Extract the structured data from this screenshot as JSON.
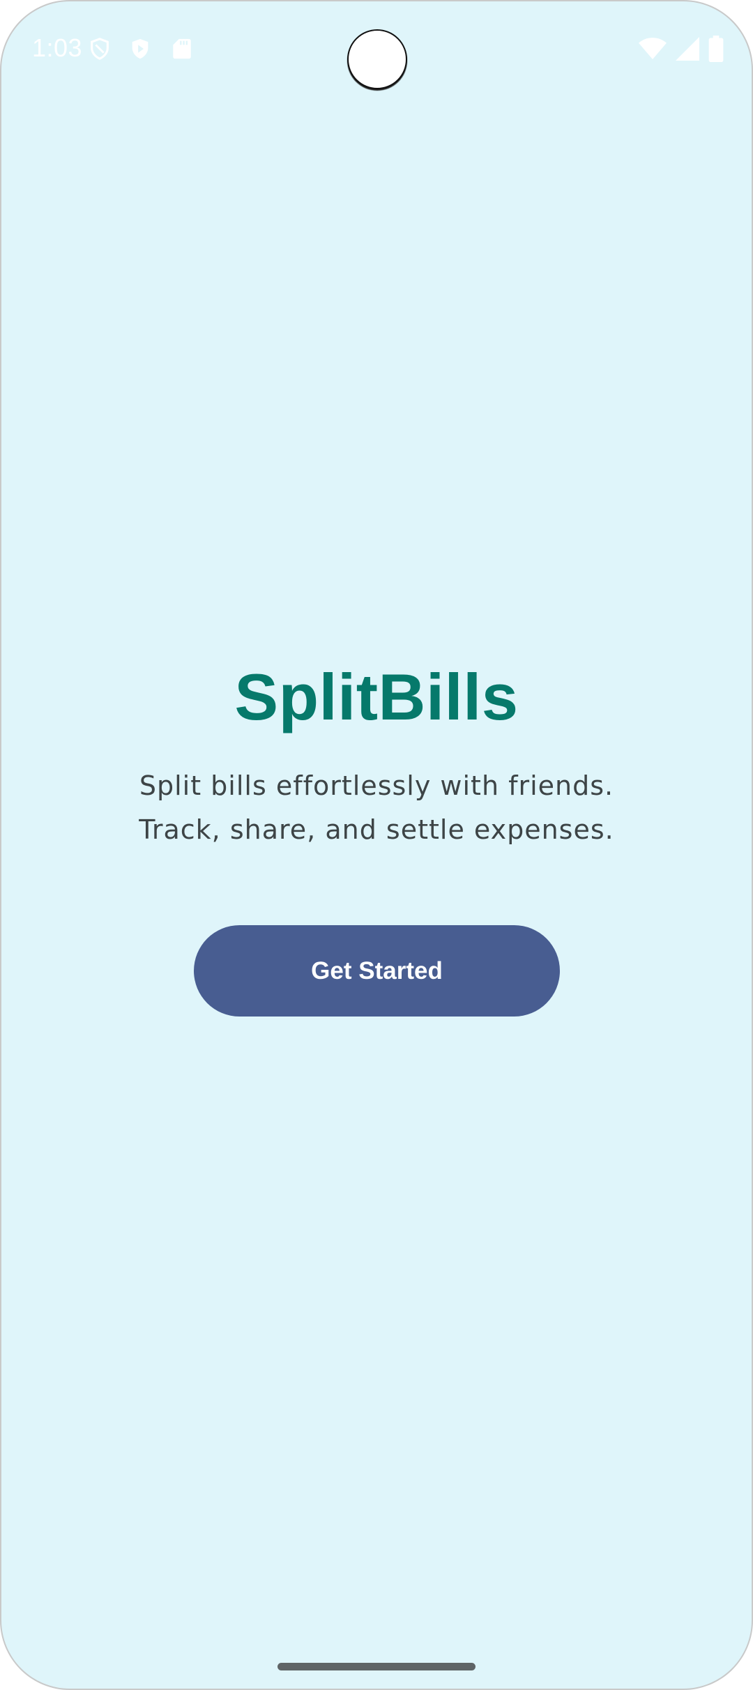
{
  "status_bar": {
    "time": "1:03",
    "left_icons": [
      "shield-icon",
      "play-protect-icon",
      "sd-card-icon"
    ],
    "right_icons": [
      "wifi-icon",
      "cellular-signal-icon",
      "battery-icon"
    ]
  },
  "main": {
    "title": "SplitBills",
    "tagline_line1": "Split bills effortlessly with friends.",
    "tagline_line2": "Track, share, and settle expenses.",
    "button_label": "Get Started"
  },
  "colors": {
    "background": "#dff5fa",
    "title": "#06796b",
    "tagline": "#3d4446",
    "button": "#485d91",
    "button_text": "#ffffff"
  }
}
